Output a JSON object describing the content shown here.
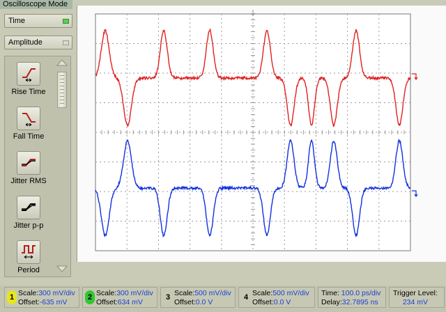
{
  "app": {
    "title": "Oscilloscope Mode"
  },
  "top_dropdowns": [
    {
      "label": "Time",
      "active": true
    },
    {
      "label": "Amplitude",
      "active": false
    }
  ],
  "measurements": [
    {
      "label": "Rise Time",
      "icon": "rise-time-icon"
    },
    {
      "label": "Fall Time",
      "icon": "fall-time-icon"
    },
    {
      "label": "Jitter RMS",
      "icon": "jitter-rms-icon"
    },
    {
      "label": "Jitter p-p",
      "icon": "jitter-pp-icon"
    },
    {
      "label": "Period",
      "icon": "period-icon"
    }
  ],
  "status": {
    "ch1": {
      "num": "1",
      "scale_key": "Scale:",
      "scale_val": "300 mV/div",
      "offset_key": "Offset:",
      "offset_val": "-635 mV",
      "color": "#e7e51d"
    },
    "ch2": {
      "num": "2",
      "scale_key": "Scale:",
      "scale_val": "300 mV/div",
      "offset_key": "Offset:",
      "offset_val": "634 mV",
      "color": "#35c534"
    },
    "ch3": {
      "num": "3",
      "scale_key": "Scale:",
      "scale_val": "500 mV/div",
      "offset_key": "Offset:",
      "offset_val": "0.0 V",
      "color": "#c6c8b4"
    },
    "ch4": {
      "num": "4",
      "scale_key": "Scale:",
      "scale_val": "500 mV/div",
      "offset_key": "Offset:",
      "offset_val": "0.0 V",
      "color": "#c6c8b4"
    },
    "time": {
      "time_key": "Time:",
      "time_val": "100.0 ps/div",
      "delay_key": "Delay:",
      "delay_val": "32.7895 ns"
    },
    "trigger": {
      "label": "Trigger Level:",
      "value": "234 mV"
    }
  },
  "colors": {
    "trace_red": "#e02020",
    "trace_blue": "#1030e0",
    "grid": "#9a9a9a"
  }
}
